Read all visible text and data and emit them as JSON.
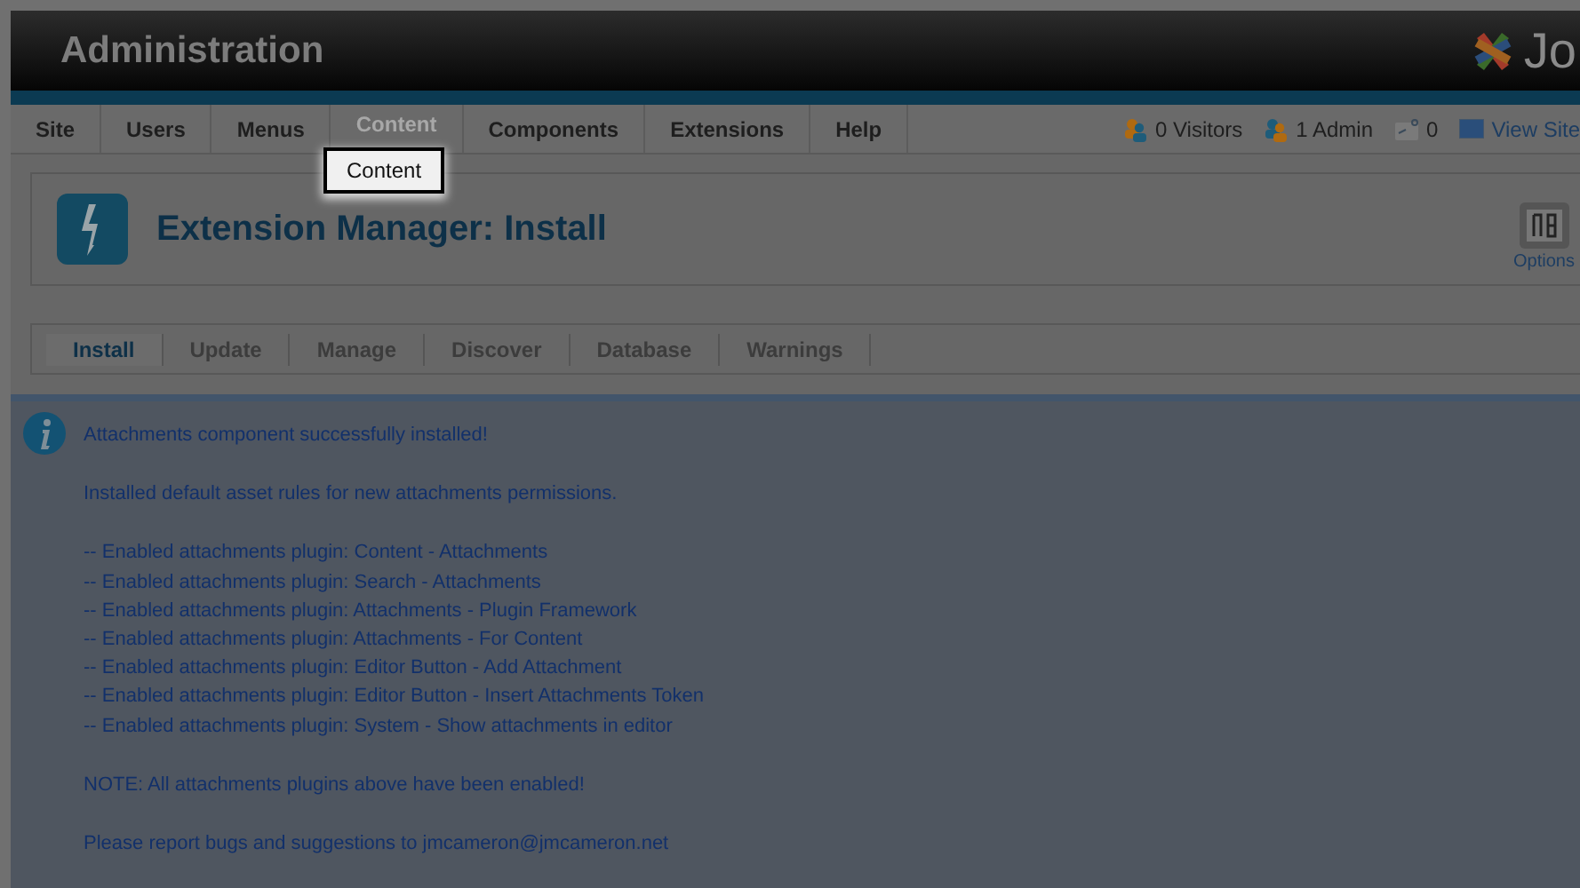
{
  "header": {
    "title": "Administration",
    "logo_text": "Jo"
  },
  "menu": [
    {
      "label": "Site",
      "covered": false
    },
    {
      "label": "Users",
      "covered": false
    },
    {
      "label": "Menus",
      "covered": false
    },
    {
      "label": "Content",
      "covered": true
    },
    {
      "label": "Components",
      "covered": false
    },
    {
      "label": "Extensions",
      "covered": false
    },
    {
      "label": "Help",
      "covered": false
    }
  ],
  "tooltip": {
    "text": "Content"
  },
  "status": [
    {
      "kind": "visitors",
      "text": "0 Visitors"
    },
    {
      "kind": "admins",
      "text": "1 Admin"
    },
    {
      "kind": "messages",
      "text": "0"
    },
    {
      "kind": "site",
      "text": "View Site"
    }
  ],
  "toolbar": {
    "title": "Extension Manager: Install",
    "options": "Options"
  },
  "submenu": [
    {
      "label": "Install",
      "selected": true
    },
    {
      "label": "Update",
      "selected": false
    },
    {
      "label": "Manage",
      "selected": false
    },
    {
      "label": "Discover",
      "selected": false
    },
    {
      "label": "Database",
      "selected": false
    },
    {
      "label": "Warnings",
      "selected": false
    }
  ],
  "message": {
    "paragraphs": [
      [
        "Attachments component successfully installed!"
      ],
      [
        "Installed default asset rules for new attachments permissions."
      ],
      [
        "-- Enabled attachments plugin: Content - Attachments",
        "-- Enabled attachments plugin: Search - Attachments",
        "-- Enabled attachments plugin: Attachments - Plugin Framework",
        "-- Enabled attachments plugin: Attachments - For Content",
        "-- Enabled attachments plugin: Editor Button - Add Attachment",
        "-- Enabled attachments plugin: Editor Button - Insert Attachments Token",
        "-- Enabled attachments plugin: System - Show attachments in editor"
      ],
      [
        "NOTE: All attachments plugins above have been enabled!"
      ],
      [
        "Please report bugs and suggestions to jmcameron@jmcameron.net"
      ]
    ]
  }
}
